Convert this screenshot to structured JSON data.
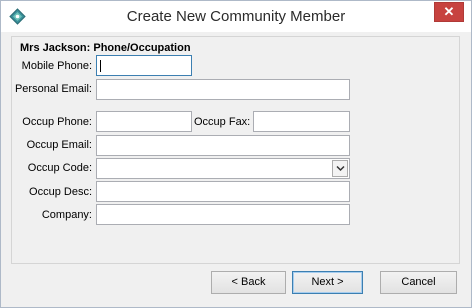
{
  "window": {
    "title": "Create New Community Member"
  },
  "titlebar": {
    "close_glyph": "✕"
  },
  "group": {
    "title": "Mrs Jackson: Phone/Occupation"
  },
  "form": {
    "mobile_phone": {
      "label": "Mobile Phone:",
      "value": ""
    },
    "personal_email": {
      "label": "Personal Email:",
      "value": ""
    },
    "occup_phone": {
      "label": "Occup Phone:",
      "value": ""
    },
    "occup_fax": {
      "label": "Occup Fax:",
      "value": ""
    },
    "occup_email": {
      "label": "Occup Email:",
      "value": ""
    },
    "occup_code": {
      "label": "Occup Code:",
      "value": ""
    },
    "occup_desc": {
      "label": "Occup Desc:",
      "value": ""
    },
    "company": {
      "label": "Company:",
      "value": ""
    }
  },
  "buttons": {
    "back": "< Back",
    "next": "Next >",
    "cancel": "Cancel"
  },
  "colors": {
    "accent": "#3c7fb1",
    "close": "#c7423f",
    "background": "#f0f0f0"
  }
}
